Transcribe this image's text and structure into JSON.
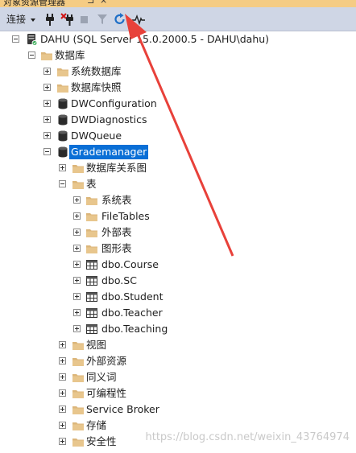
{
  "window": {
    "title": "对象资源管理器",
    "pin_glyph": "⊐",
    "close_glyph": "×"
  },
  "toolbar": {
    "connect_label": "连接",
    "icons": [
      "connect-plug-icon",
      "disconnect-plug-icon",
      "stop-icon",
      "filter-icon",
      "refresh-icon",
      "activity-monitor-icon"
    ]
  },
  "tree": [
    {
      "label": "DAHU (SQL Server 15.0.2000.5 - DAHU\\dahu)",
      "level": 0,
      "icon": "server",
      "exp": "minus"
    },
    {
      "label": "数据库",
      "level": 1,
      "icon": "folder",
      "exp": "minus"
    },
    {
      "label": "系统数据库",
      "level": 2,
      "icon": "folder",
      "exp": "plus"
    },
    {
      "label": "数据库快照",
      "level": 2,
      "icon": "folder",
      "exp": "plus"
    },
    {
      "label": "DWConfiguration",
      "level": 2,
      "icon": "db",
      "exp": "plus"
    },
    {
      "label": "DWDiagnostics",
      "level": 2,
      "icon": "db",
      "exp": "plus"
    },
    {
      "label": "DWQueue",
      "level": 2,
      "icon": "db",
      "exp": "plus"
    },
    {
      "label": "Grademanager",
      "level": 2,
      "icon": "db",
      "exp": "minus",
      "selected": true
    },
    {
      "label": "数据库关系图",
      "level": 3,
      "icon": "folder",
      "exp": "plus"
    },
    {
      "label": "表",
      "level": 3,
      "icon": "folder",
      "exp": "minus"
    },
    {
      "label": "系统表",
      "level": 4,
      "icon": "folder",
      "exp": "plus"
    },
    {
      "label": "FileTables",
      "level": 4,
      "icon": "folder",
      "exp": "plus"
    },
    {
      "label": "外部表",
      "level": 4,
      "icon": "folder",
      "exp": "plus"
    },
    {
      "label": "图形表",
      "level": 4,
      "icon": "folder",
      "exp": "plus"
    },
    {
      "label": "dbo.Course",
      "level": 4,
      "icon": "table",
      "exp": "plus"
    },
    {
      "label": "dbo.SC",
      "level": 4,
      "icon": "table",
      "exp": "plus"
    },
    {
      "label": "dbo.Student",
      "level": 4,
      "icon": "table",
      "exp": "plus"
    },
    {
      "label": "dbo.Teacher",
      "level": 4,
      "icon": "table",
      "exp": "plus"
    },
    {
      "label": "dbo.Teaching",
      "level": 4,
      "icon": "table",
      "exp": "plus"
    },
    {
      "label": "视图",
      "level": 3,
      "icon": "folder",
      "exp": "plus"
    },
    {
      "label": "外部资源",
      "level": 3,
      "icon": "folder",
      "exp": "plus"
    },
    {
      "label": "同义词",
      "level": 3,
      "icon": "folder",
      "exp": "plus"
    },
    {
      "label": "可编程性",
      "level": 3,
      "icon": "folder",
      "exp": "plus"
    },
    {
      "label": "Service Broker",
      "level": 3,
      "icon": "folder",
      "exp": "plus"
    },
    {
      "label": "存储",
      "level": 3,
      "icon": "folder",
      "exp": "plus"
    },
    {
      "label": "安全性",
      "level": 3,
      "icon": "folder",
      "exp": "plus"
    }
  ],
  "watermark": "https://blog.csdn.net/weixin_43764974",
  "colors": {
    "titlebar": "#f5cc84",
    "toolbar": "#cfd6e5",
    "selection": "#0a6fd6",
    "folder": "#dcb67a",
    "arrow": "#e8413a",
    "refresh": "#1e6fc7"
  }
}
